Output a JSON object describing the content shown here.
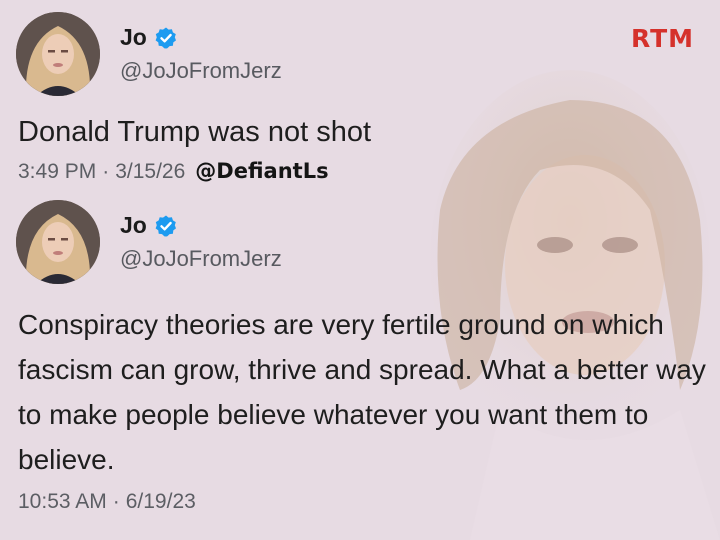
{
  "brand": {
    "logo_text": "RTM",
    "color": "#d5312b"
  },
  "background": {
    "color": "#e7dbe3"
  },
  "tweets": [
    {
      "name": "Jo",
      "handle": "@JoJoFromJerz",
      "verified": true,
      "text": "Donald Trump was not shot",
      "time": "3:49 PM",
      "date": "3/15/26",
      "separator": "·",
      "watermark": "@DefiantLs"
    },
    {
      "name": "Jo",
      "handle": "@JoJoFromJerz",
      "verified": true,
      "text": "Conspiracy theories are very fertile ground on which fascism can grow, thrive and spread. What a better way to make people believe whatever you want them to believe.",
      "time": "10:53 AM",
      "date": "6/19/23",
      "separator": "·"
    }
  ],
  "icons": {
    "verified": "verified-badge-icon",
    "avatar": "profile-photo"
  },
  "colors": {
    "verified": "#1d9bf0",
    "secondary_text": "#585a60"
  }
}
